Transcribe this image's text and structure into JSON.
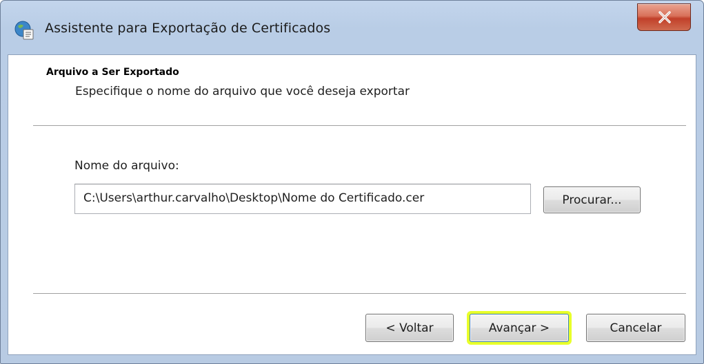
{
  "window": {
    "title": "Assistente para Exportação de Certificados",
    "close_symbol": "X"
  },
  "section": {
    "heading": "Arquivo a Ser Exportado",
    "description": "Especifique o nome do arquivo que você deseja exportar"
  },
  "file": {
    "label": "Nome do arquivo:",
    "value": "C:\\Users\\arthur.carvalho\\Desktop\\Nome do Certificado.cer",
    "browse_label": "Procurar..."
  },
  "footer": {
    "back_label": "< Voltar",
    "next_label": "Avançar >",
    "cancel_label": "Cancelar"
  },
  "icons": {
    "title": "certificate-wizard-icon",
    "close": "close-icon"
  },
  "colors": {
    "title_bar": "#c3d5ec",
    "close_button": "#c1402a",
    "next_button_highlight": "#e8ff2a"
  }
}
